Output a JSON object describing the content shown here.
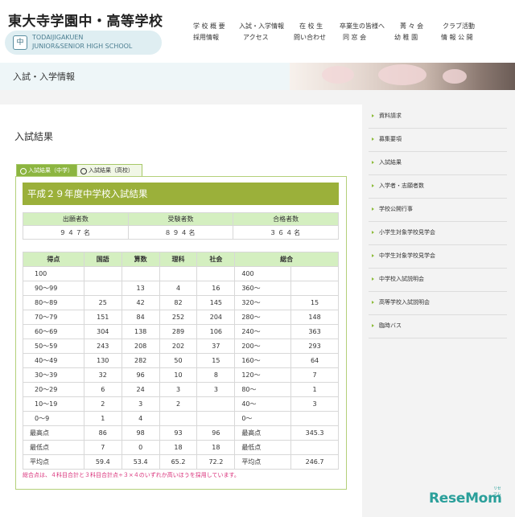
{
  "header": {
    "title": "東大寺学園中・高等学校",
    "emblem": "中",
    "en_line1": "TODAIJIGAKUEN",
    "en_line2": "JUNIOR&SENIOR HIGH SCHOOL"
  },
  "nav": {
    "row1": [
      "学 校 概 要",
      "入試・入学情報",
      "在 校 生",
      "卒業生の皆様へ",
      "菁 々 会",
      "クラブ活動"
    ],
    "row2": [
      "採用情報",
      "アクセス",
      "問い合わせ",
      "同 窓 会",
      "幼 稚 園",
      "情 報 公 開"
    ]
  },
  "banner": {
    "title": "入試・入学情報"
  },
  "page": {
    "heading": "入試結果"
  },
  "tabs": {
    "active": "入試結果（中学）",
    "inactive": "入試結果（高校）"
  },
  "results": {
    "caption": "平成２９年度中学校入試結果",
    "applicants_headers": [
      "出願者数",
      "受験者数",
      "合格者数"
    ],
    "applicants_values": [
      "９４７名",
      "８９４名",
      "３６４名"
    ],
    "score_headers": [
      "得点",
      "国語",
      "算数",
      "理科",
      "社会",
      "総合"
    ],
    "rows": [
      [
        "100",
        "",
        "",
        "",
        "",
        "400",
        ""
      ],
      [
        "90〜99",
        "",
        "13",
        "4",
        "16",
        "360〜",
        ""
      ],
      [
        "80〜89",
        "25",
        "42",
        "82",
        "145",
        "320〜",
        "15"
      ],
      [
        "70〜79",
        "151",
        "84",
        "252",
        "204",
        "280〜",
        "148"
      ],
      [
        "60〜69",
        "304",
        "138",
        "289",
        "106",
        "240〜",
        "363"
      ],
      [
        "50〜59",
        "243",
        "208",
        "202",
        "37",
        "200〜",
        "293"
      ],
      [
        "40〜49",
        "130",
        "282",
        "50",
        "15",
        "160〜",
        "64"
      ],
      [
        "30〜39",
        "32",
        "96",
        "10",
        "8",
        "120〜",
        "7"
      ],
      [
        "20〜29",
        "6",
        "24",
        "3",
        "3",
        "80〜",
        "1"
      ],
      [
        "10〜19",
        "2",
        "3",
        "2",
        "",
        "40〜",
        "3"
      ],
      [
        "0〜9",
        "1",
        "4",
        "",
        "",
        "0〜",
        ""
      ],
      [
        "最高点",
        "86",
        "98",
        "93",
        "96",
        "最高点",
        "345.3"
      ],
      [
        "最低点",
        "7",
        "0",
        "18",
        "18",
        "最低点",
        ""
      ],
      [
        "平均点",
        "59.4",
        "53.4",
        "65.2",
        "72.2",
        "平均点",
        "246.7"
      ]
    ],
    "note": "総合点は、４科目合計と３科目合計点÷３×４のいずれか高いほうを採用しています。"
  },
  "sidebar": {
    "items": [
      "資料請求",
      "募集要項",
      "入試結果",
      "入学者・志願者数",
      "学校公開行事",
      "小学生対象学校見学会",
      "中学生対象学校見学会",
      "中学校入試説明会",
      "高等学校入試説明会",
      "臨時バス"
    ]
  },
  "watermark": {
    "text": "ReseMom",
    "sub": "リセマム"
  },
  "colors": {
    "accent_green": "#8cb540",
    "caption_olive": "#9bb03a",
    "header_green": "#d4efc0",
    "note_pink": "#d9307a"
  }
}
